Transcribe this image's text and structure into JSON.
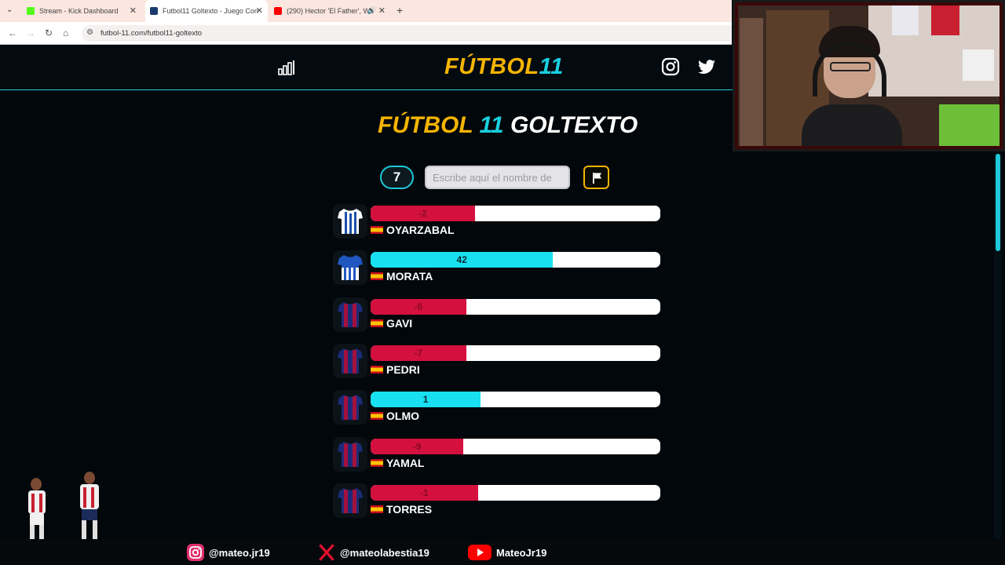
{
  "browser": {
    "tabs": [
      {
        "title": "Stream - Kick Dashboard",
        "favicon_color": "#53fc18"
      },
      {
        "title": "Futbol11 Goltexto - Juego Con",
        "favicon_color": "#1a3a6e"
      },
      {
        "title": "(290) Hector 'El Father', Wa",
        "favicon_color": "#ff0000"
      }
    ],
    "url": "futbol-11.com/futbol11-goltexto"
  },
  "header": {
    "brand_part1": "FÚTBOL",
    "brand_part2": "11"
  },
  "game": {
    "title_part1": "FÚTBOL",
    "title_part2": "11",
    "title_part3": "GOLTEXTO",
    "attempts": "7",
    "search_placeholder": "Escribe aquí el nombre de",
    "rows": [
      {
        "name": "OYARZABAL",
        "value": "-2",
        "fill": 0.36,
        "color": "#d4103f",
        "text_color": "#8a0a25",
        "shirt": "realsociedad"
      },
      {
        "name": "MORATA",
        "value": "42",
        "fill": 0.63,
        "color": "#19e0f0",
        "text_color": "#0a2a33",
        "shirt": "alaves"
      },
      {
        "name": "GAVI",
        "value": "-6",
        "fill": 0.33,
        "color": "#d4103f",
        "text_color": "#8a0a25",
        "shirt": "barca"
      },
      {
        "name": "PEDRI",
        "value": "-7",
        "fill": 0.33,
        "color": "#d4103f",
        "text_color": "#8a0a25",
        "shirt": "barca"
      },
      {
        "name": "OLMO",
        "value": "1",
        "fill": 0.38,
        "color": "#19e0f0",
        "text_color": "#0a2a33",
        "shirt": "barca"
      },
      {
        "name": "YAMAL",
        "value": "-9",
        "fill": 0.32,
        "color": "#d4103f",
        "text_color": "#8a0a25",
        "shirt": "barca"
      },
      {
        "name": "TORRES",
        "value": "-1",
        "fill": 0.37,
        "color": "#d4103f",
        "text_color": "#8a0a25",
        "shirt": "barca"
      }
    ]
  },
  "footer": {
    "instagram": "@mateo.jr19",
    "x": "@mateolabestia19",
    "youtube": "MateoJr19"
  },
  "colors": {
    "accent_cyan": "#1ec8d8",
    "accent_gold": "#f5b400",
    "bg": "#02070b"
  }
}
